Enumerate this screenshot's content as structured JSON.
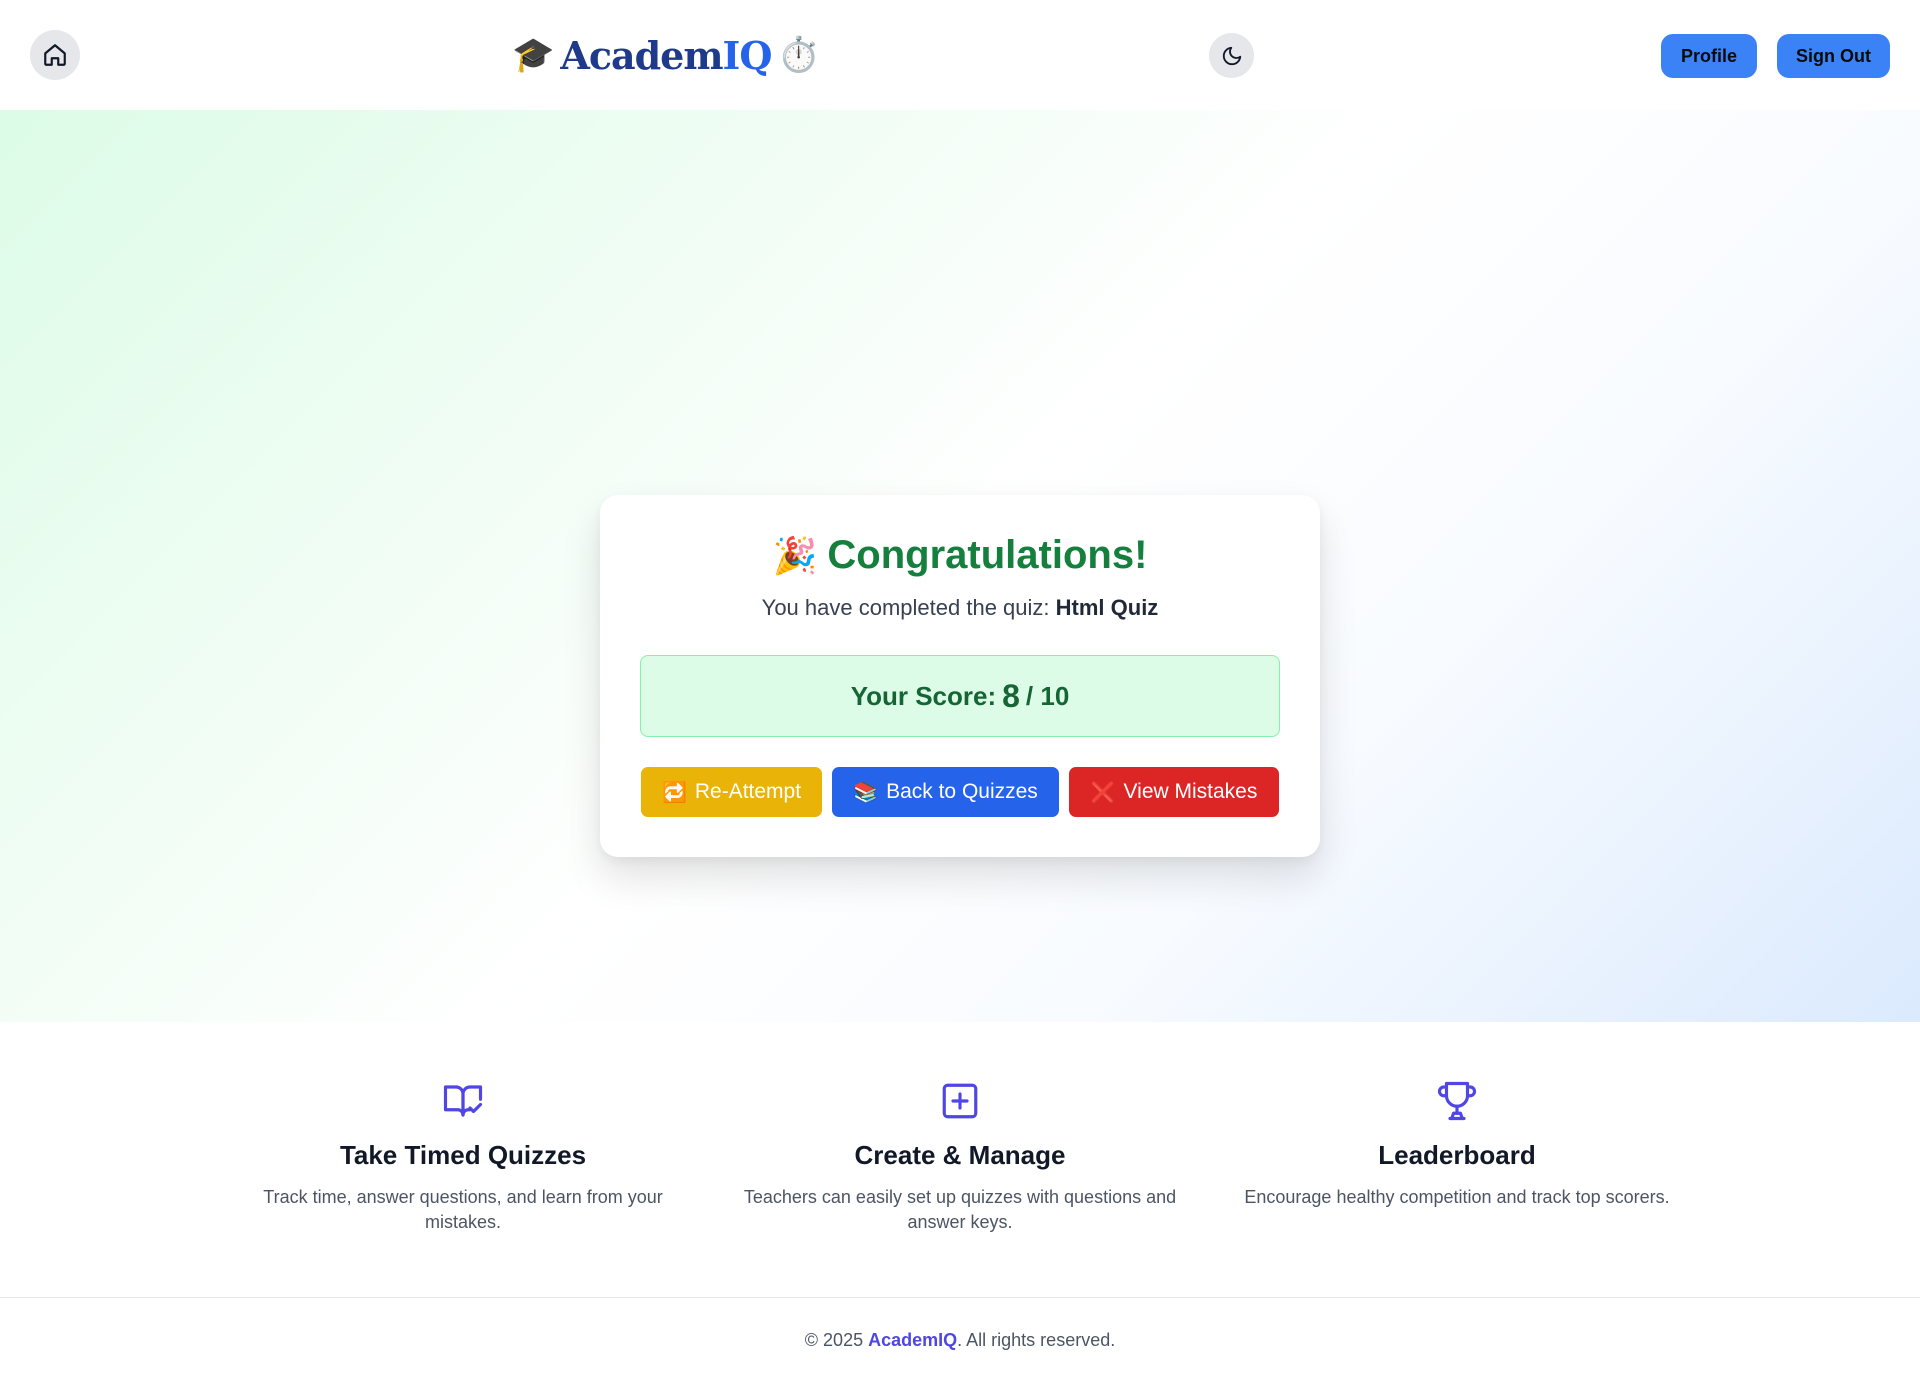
{
  "header": {
    "logo": {
      "part1": "Academ",
      "part2": "IQ",
      "cap_emoji": "🎓",
      "watch_emoji": "⏱️"
    },
    "home_icon": "home-icon",
    "theme_icon": "moon-icon",
    "profile_label": "Profile",
    "signout_label": "Sign Out"
  },
  "result": {
    "emoji": "🎉",
    "title": "Congratulations!",
    "subtitle_prefix": "You have completed the quiz:",
    "quiz_name": "Html Quiz",
    "score_label": "Your Score:",
    "score": "8",
    "total": "/ 10",
    "actions": [
      {
        "emoji": "🔁",
        "label": "Re-Attempt"
      },
      {
        "emoji": "📚",
        "label": "Back to Quizzes"
      },
      {
        "emoji": "❌",
        "label": "View Mistakes"
      }
    ]
  },
  "features": [
    {
      "icon": "book-check-icon",
      "title": "Take Timed Quizzes",
      "desc": "Track time, answer questions, and learn from your mistakes."
    },
    {
      "icon": "plus-square-icon",
      "title": "Create & Manage",
      "desc": "Teachers can easily set up quizzes with questions and answer keys."
    },
    {
      "icon": "trophy-icon",
      "title": "Leaderboard",
      "desc": "Encourage healthy competition and track top scorers."
    }
  ],
  "footer": {
    "prefix": "© 2025",
    "brand": "AcademIQ",
    "suffix": ". All rights reserved."
  },
  "colors": {
    "accent": "#3b82f6",
    "success": "#15803d",
    "warning": "#eab308",
    "primary": "#2563eb",
    "danger": "#dc2626",
    "feature_icon": "#4f46e5"
  }
}
